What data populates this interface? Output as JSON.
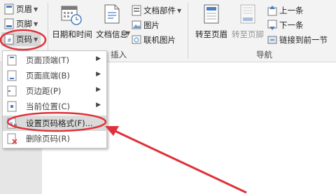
{
  "ribbon": {
    "header_footer": {
      "header_label": "页眉",
      "footer_label": "页脚",
      "page_number_label": "页码"
    },
    "insert_group": {
      "date_time_label": "日期和时间",
      "doc_info_label": "文档信息",
      "doc_parts_label": "文档部件",
      "picture_label": "图片",
      "online_picture_label": "联机图片",
      "group_label": "插入"
    },
    "navigation_group": {
      "goto_header_label": "转至页眉",
      "goto_footer_label": "转至页脚",
      "previous_label": "上一条",
      "next_label": "下一条",
      "link_previous_label": "链接到前一节",
      "group_label": "导航"
    }
  },
  "page_number_menu": {
    "items": [
      {
        "label": "页面顶端(T)",
        "icon": "page-top-icon",
        "submenu": true
      },
      {
        "label": "页面底端(B)",
        "icon": "page-bottom-icon",
        "submenu": true
      },
      {
        "label": "页边距(P)",
        "icon": "page-margin-icon",
        "submenu": true
      },
      {
        "label": "当前位置(C)",
        "icon": "current-position-icon",
        "submenu": true
      },
      {
        "label": "设置页码格式(F)...",
        "icon": "format-page-number-icon",
        "submenu": false,
        "highlighted": true
      },
      {
        "label": "删除页码(R)",
        "icon": "remove-page-number-icon",
        "submenu": false
      }
    ]
  },
  "annotation": {
    "color": "#e0313a"
  }
}
